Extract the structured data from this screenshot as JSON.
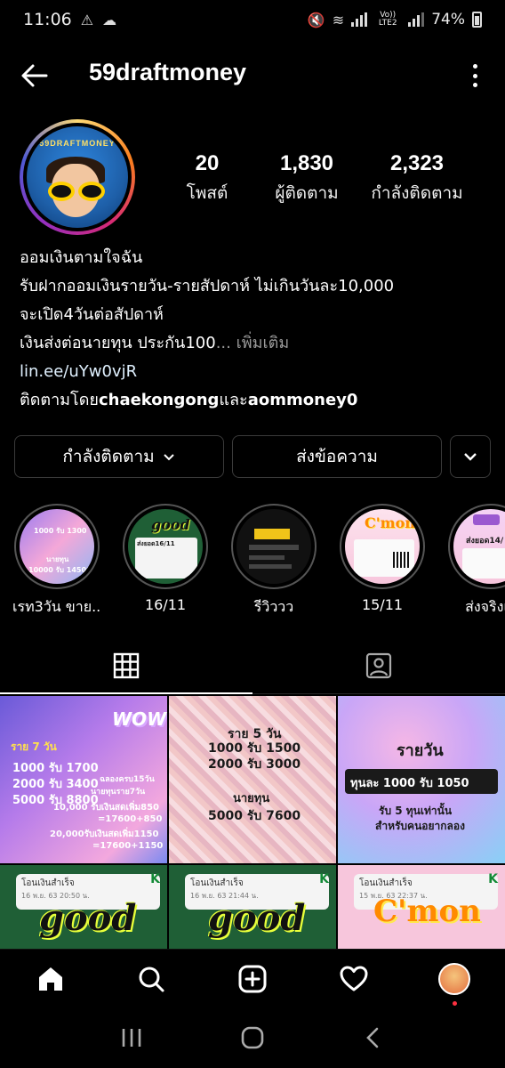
{
  "status_bar": {
    "time": "11:06",
    "network_label": "Vo)) LTE2",
    "battery": "74%"
  },
  "header": {
    "username": "59draftmoney",
    "back_icon": "arrow-left-icon",
    "more_icon": "vertical-ellipsis-icon"
  },
  "profile": {
    "avatar_text": "59DRAFTMONEY",
    "stats": [
      {
        "value": "20",
        "label": "โพสต์"
      },
      {
        "value": "1,830",
        "label": "ผู้ติดตาม"
      },
      {
        "value": "2,323",
        "label": "กำลังติดตาม"
      }
    ],
    "bio": {
      "line1": "ออมเงินตามใจฉัน",
      "line2": "รับฝากออมเงินรายวัน-รายสัปดาห์ ไม่เกินวันละ10,000",
      "line3": "จะเปิด4วันต่อสัปดาห์",
      "line4": "เงินส่งต่อนายทุน ประกัน100",
      "more": "... เพิ่มเติม",
      "link": "lin.ee/uYw0vjR",
      "followed_prefix": "ติดตามโดย ",
      "followed_user1": "chaekongong",
      "followed_and": " และ ",
      "followed_user2": "aommoney0"
    }
  },
  "actions": {
    "following": "กำลังติดตาม",
    "message": "ส่งข้อความ"
  },
  "highlights": [
    {
      "label": "เรท3วัน ขาย...",
      "image_text_1": "1000 รับ 1300",
      "image_text_2": "นายทุน",
      "image_text_3": "10000 รับ 14500"
    },
    {
      "label": "16/11",
      "image_text_1": "good",
      "image_text_2": "ส่งยอด16/11"
    },
    {
      "label": "รีวิววว"
    },
    {
      "label": "15/11",
      "image_text_1": "C'mon"
    },
    {
      "label": "ส่งจริงเว",
      "image_text_1": "ส่งยอด14/"
    }
  ],
  "tabs": [
    {
      "name": "grid",
      "icon": "grid-icon"
    },
    {
      "name": "tagged",
      "icon": "tagged-person-icon"
    }
  ],
  "posts": [
    {
      "title": "ราย 7 วัน",
      "lines": [
        "1000 รับ 1700",
        "2000 รับ 3400",
        "5000 รับ 8800"
      ],
      "badge": "WOW!",
      "side": [
        "ฉลองครบ15วัน",
        "นายทุนราย7วัน"
      ],
      "extra": [
        "10,000 รับเงินสดเพิ่ม850",
        "=17600+850",
        "20,000รับเงินสดเพิ่ม1150",
        "=17600+1150"
      ]
    },
    {
      "title": "ราย 5 วัน",
      "lines": [
        "1000 รับ 1500",
        "2000 รับ 3000"
      ],
      "sub": "นายทุน",
      "sub_line": "5000 รับ 7600"
    },
    {
      "title": "รายวัน",
      "box": "ทุนละ 1000 รับ 1050",
      "lines": [
        "รับ 5 ทุนเท่านั้น",
        "สำหรับคนอยากลอง"
      ]
    },
    {
      "receipt_title": "โอนเงินสำเร็จ",
      "receipt_date": "16 พ.ย. 63 20:50 น.",
      "sticker": "good"
    },
    {
      "receipt_title": "โอนเงินสำเร็จ",
      "receipt_date": "16 พ.ย. 63 21:44 น.",
      "sticker": "good"
    },
    {
      "receipt_title": "โอนเงินสำเร็จ",
      "receipt_date": "15 พ.ย. 63 22:37 น.",
      "sticker": "C'mon"
    }
  ],
  "bottom_nav": [
    "home-icon",
    "search-icon",
    "add-post-icon",
    "heart-icon",
    "profile-avatar"
  ],
  "system_nav": [
    "recent-apps-icon",
    "home-button-icon",
    "back-icon"
  ]
}
